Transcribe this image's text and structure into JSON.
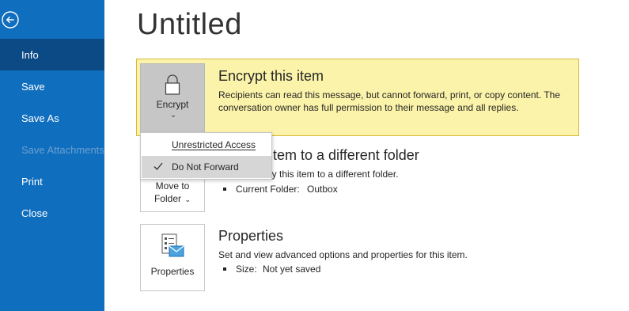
{
  "sidebar": {
    "back_icon": "back-arrow-icon",
    "items": [
      {
        "label": "Info",
        "state": "active"
      },
      {
        "label": "Save",
        "state": "normal"
      },
      {
        "label": "Save As",
        "state": "normal"
      },
      {
        "label": "Save Attachments",
        "state": "disabled"
      },
      {
        "label": "Print",
        "state": "normal"
      },
      {
        "label": "Close",
        "state": "normal"
      }
    ]
  },
  "page": {
    "title": "Untitled"
  },
  "encrypt": {
    "button_label": "Encrypt",
    "icon": "lock-icon",
    "title": "Encrypt this item",
    "description": "Recipients can read this message, but cannot forward, print, or copy content. The conversation owner has full permission to their message and all replies."
  },
  "dropdown": {
    "items": [
      {
        "label": "Unrestricted Access",
        "checked": false
      },
      {
        "label": "Do Not Forward",
        "checked": true
      }
    ]
  },
  "move": {
    "button_line1": "Move to",
    "button_line2": "Folder",
    "title_visible": "item to a different folder",
    "desc_visible": "ly this item to a different folder.",
    "current_folder_label": "Current Folder:",
    "current_folder_value": "Outbox"
  },
  "properties": {
    "button_label": "Properties",
    "icon": "properties-icon",
    "title": "Properties",
    "description": "Set and view advanced options and properties for this item.",
    "size_label": "Size:",
    "size_value": "Not yet saved"
  },
  "colors": {
    "sidebar": "#106ebe",
    "sidebar_active": "#0b4a85",
    "encrypt_panel": "#fbf3a9",
    "encrypt_border": "#d7b93a"
  }
}
